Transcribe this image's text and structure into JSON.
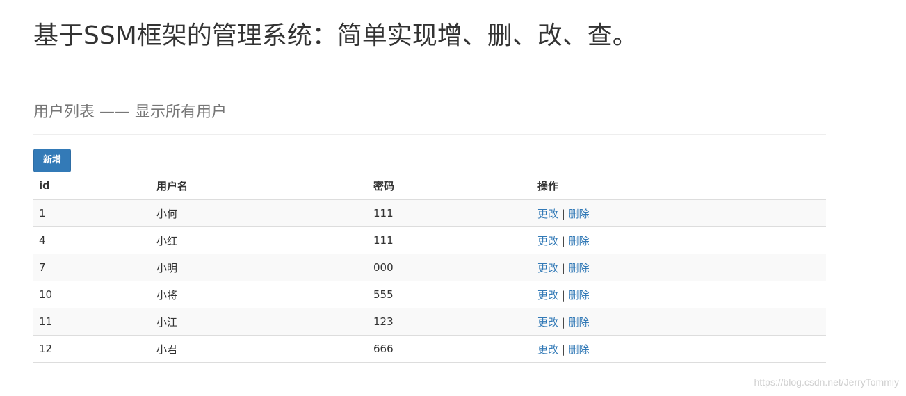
{
  "page": {
    "title": "基于SSM框架的管理系统：简单实现增、删、改、查。",
    "subtitle": "用户列表 —— 显示所有用户"
  },
  "toolbar": {
    "add_label": "新增"
  },
  "table": {
    "columns": [
      "id",
      "用户名",
      "密码",
      "操作"
    ],
    "rows": [
      {
        "id": "1",
        "username": "小何",
        "password": "111",
        "edit": "更改",
        "sep": "|",
        "delete": "删除"
      },
      {
        "id": "4",
        "username": "小红",
        "password": "111",
        "edit": "更改",
        "sep": "|",
        "delete": "删除"
      },
      {
        "id": "7",
        "username": "小明",
        "password": "000",
        "edit": "更改",
        "sep": "|",
        "delete": "删除"
      },
      {
        "id": "10",
        "username": "小将",
        "password": "555",
        "edit": "更改",
        "sep": "|",
        "delete": "删除"
      },
      {
        "id": "11",
        "username": "小江",
        "password": "123",
        "edit": "更改",
        "sep": "|",
        "delete": "删除"
      },
      {
        "id": "12",
        "username": "小君",
        "password": "666",
        "edit": "更改",
        "sep": "|",
        "delete": "删除"
      }
    ]
  },
  "watermark": "https://blog.csdn.net/JerryTommiy",
  "colors": {
    "primary": "#337ab7",
    "link": "#337ab7",
    "stripe": "#f9f9f9",
    "border": "#dddddd"
  }
}
